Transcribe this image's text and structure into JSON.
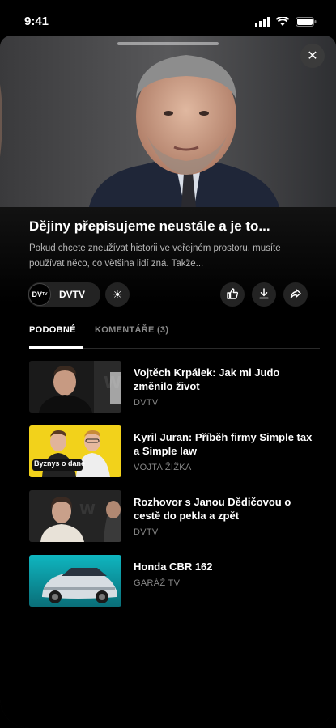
{
  "status_bar": {
    "time": "9:41"
  },
  "video": {
    "close_label": "✕"
  },
  "episode": {
    "title": "Dějiny přepisujeme neustále a je to...",
    "description": "Pokud chcete zneužívat historii ve veřejném prostoru, musíte používat něco, co většina lidí zná. Takže..."
  },
  "channel": {
    "logo_text": "DV",
    "logo_sup": "TV",
    "name": "DVTV"
  },
  "actions": {
    "brightness_icon": "☀",
    "like_icon": "👍",
    "download_icon": "⤓",
    "share_icon": "➦"
  },
  "tabs": [
    {
      "label": "PODOBNÉ",
      "active": true
    },
    {
      "label": "KOMENTÁŘE (3)",
      "active": false
    }
  ],
  "related": [
    {
      "title": "Vojtěch Krpálek: Jak mi Judo změnilo život",
      "channel": "DVTV"
    },
    {
      "title": "Kyril Juran: Příběh firmy Simple tax a Simple law",
      "channel": "VOJTA ŽIŽKA",
      "thumb_caption": "Byznys o daně"
    },
    {
      "title": "Rozhovor s Janou Dědičovou o cestě do pekla a zpět",
      "channel": "DVTV"
    },
    {
      "title": "Honda CBR 162",
      "channel": "GARÁŽ TV"
    }
  ],
  "colors": {
    "background": "#000000",
    "accent_yellow": "#f2d21b",
    "muted": "#888888"
  }
}
